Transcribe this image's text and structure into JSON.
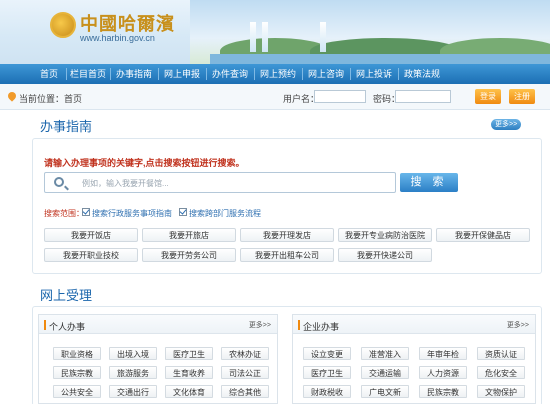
{
  "header": {
    "site_title": "中國哈爾濱",
    "site_url": "www.harbin.gov.cn"
  },
  "nav": {
    "items": [
      "首页",
      "栏目首页",
      "办事指南",
      "网上申报",
      "办件查询",
      "网上预约",
      "网上咨询",
      "网上投诉",
      "政策法规"
    ]
  },
  "topbar": {
    "location_label": "当前位置：首页",
    "username_label": "用户名：",
    "password_label": "密码：",
    "login_label": "登录",
    "register_label": "注册"
  },
  "guide": {
    "title": "办事指南",
    "more_label": "更多>>",
    "hint": "请输入办理事项的关键字,点击搜索按钮进行搜索。",
    "search_placeholder": "例如，输入我要开餐馆...",
    "search_button": "搜 索",
    "scope_label": "搜索范围：",
    "scope_options": [
      "搜索行政服务事项指南",
      "搜索跨部门服务流程"
    ],
    "quick_items": [
      "我要开饭店",
      "我要开旅店",
      "我要开理发店",
      "我要开专业病防治医院",
      "我要开保健品店",
      "我要开职业技校",
      "我要开劳务公司",
      "我要开出租车公司",
      "我要开快递公司"
    ]
  },
  "online": {
    "title": "网上受理",
    "personal": {
      "title": "个人办事",
      "more_label": "更多>>",
      "items": [
        "职业资格",
        "出境入境",
        "医疗卫生",
        "农林办证",
        "民族宗教",
        "旅游服务",
        "生育收养",
        "司法公正",
        "公共安全",
        "交通出行",
        "文化体育",
        "综合其他"
      ]
    },
    "enterprise": {
      "title": "企业办事",
      "more_label": "更多>>",
      "items": [
        "设立变更",
        "准营准入",
        "年审年检",
        "资质认证",
        "医疗卫生",
        "交通运输",
        "人力资源",
        "危化安全",
        "财政税收",
        "广电文新",
        "民族宗教",
        "文物保护"
      ]
    }
  },
  "colors": {
    "nav": "#2a82c7",
    "accent": "#f08a10",
    "alert": "#c0321e",
    "link": "#1b66ac"
  }
}
